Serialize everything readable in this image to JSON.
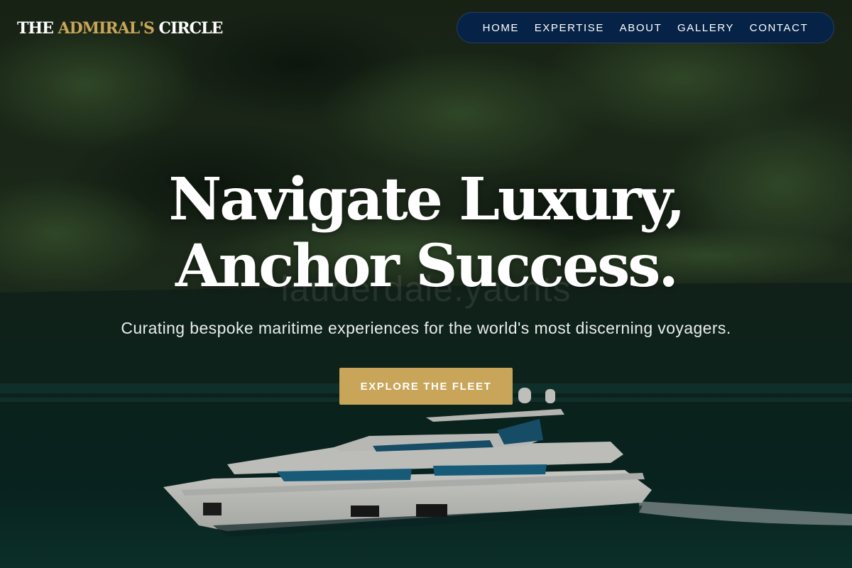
{
  "brand": {
    "logo_part_1": "THE ",
    "logo_part_2": "ADMIRAL'S",
    "logo_part_3": " CIRCLE",
    "gold": "#c9a55a",
    "navy": "#062347"
  },
  "nav": {
    "items": [
      {
        "label": "HOME"
      },
      {
        "label": "EXPERTISE"
      },
      {
        "label": "ABOUT"
      },
      {
        "label": "GALLERY"
      },
      {
        "label": "CONTACT"
      }
    ]
  },
  "hero": {
    "headline_line_1": "Navigate Luxury,",
    "headline_line_2": "Anchor Success.",
    "subtitle": "Curating bespoke maritime experiences for the world's most discerning voyagers.",
    "cta_label": "EXPLORE THE FLEET",
    "watermark": "lauderdale.yachts",
    "background": "forested-hillside-with-motor-yacht-on-water"
  }
}
